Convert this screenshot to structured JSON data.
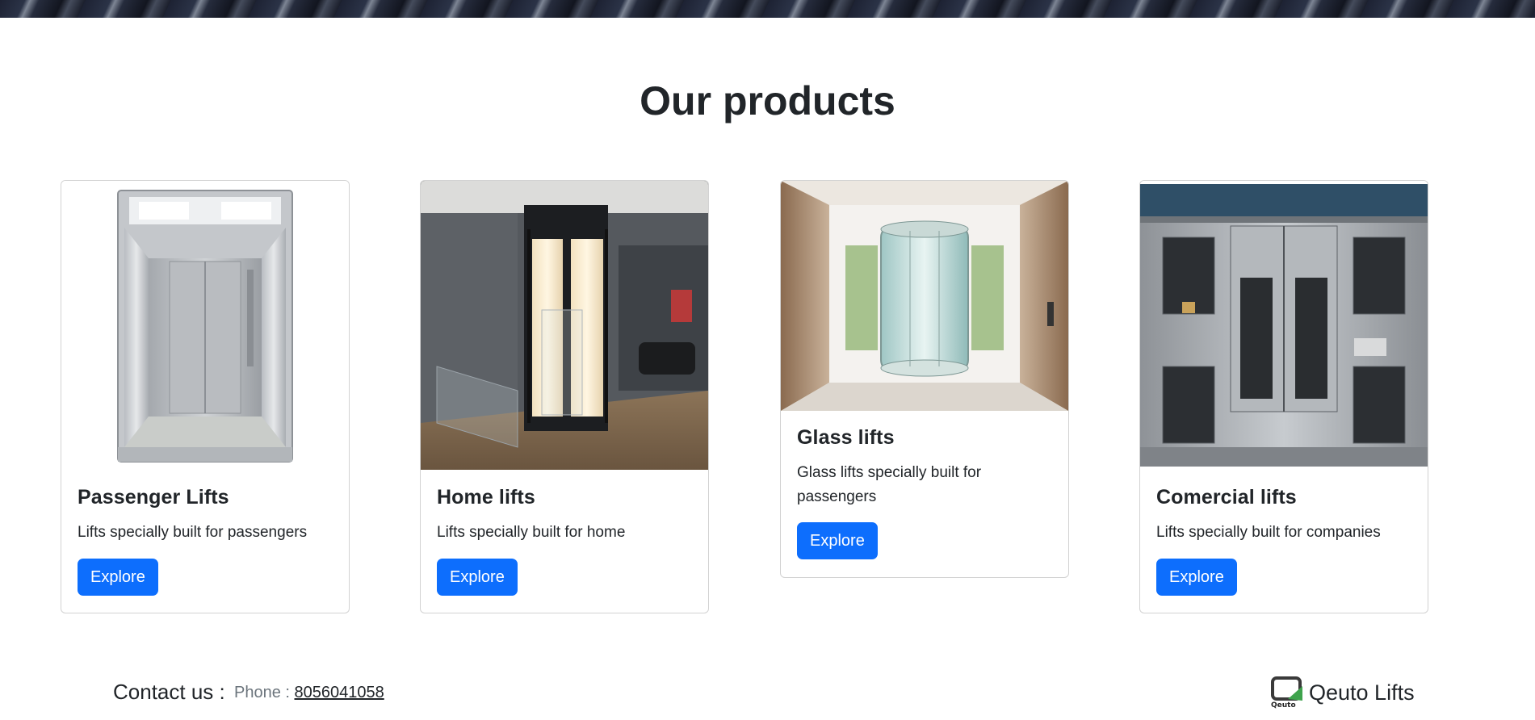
{
  "page": {
    "title": "Our products"
  },
  "products": [
    {
      "title": "Passenger Lifts",
      "description": "Lifts specially built for passengers",
      "button_label": "Explore"
    },
    {
      "title": "Home lifts",
      "description": "Lifts specially built for home",
      "button_label": "Explore"
    },
    {
      "title": "Glass lifts",
      "description": "Glass lifts specially built for passengers",
      "button_label": "Explore"
    },
    {
      "title": "Comercial lifts",
      "description": "Lifts specially built for companies",
      "button_label": "Explore"
    }
  ],
  "footer": {
    "contact_label": "Contact us :",
    "phone_label": "Phone :",
    "phone_number": "8056041058",
    "brand_name": "Qeuto Lifts",
    "logo_text": "Qeuto"
  },
  "colors": {
    "primary_button": "#0d6efd",
    "text": "#212529",
    "muted_text": "#6c757d"
  }
}
